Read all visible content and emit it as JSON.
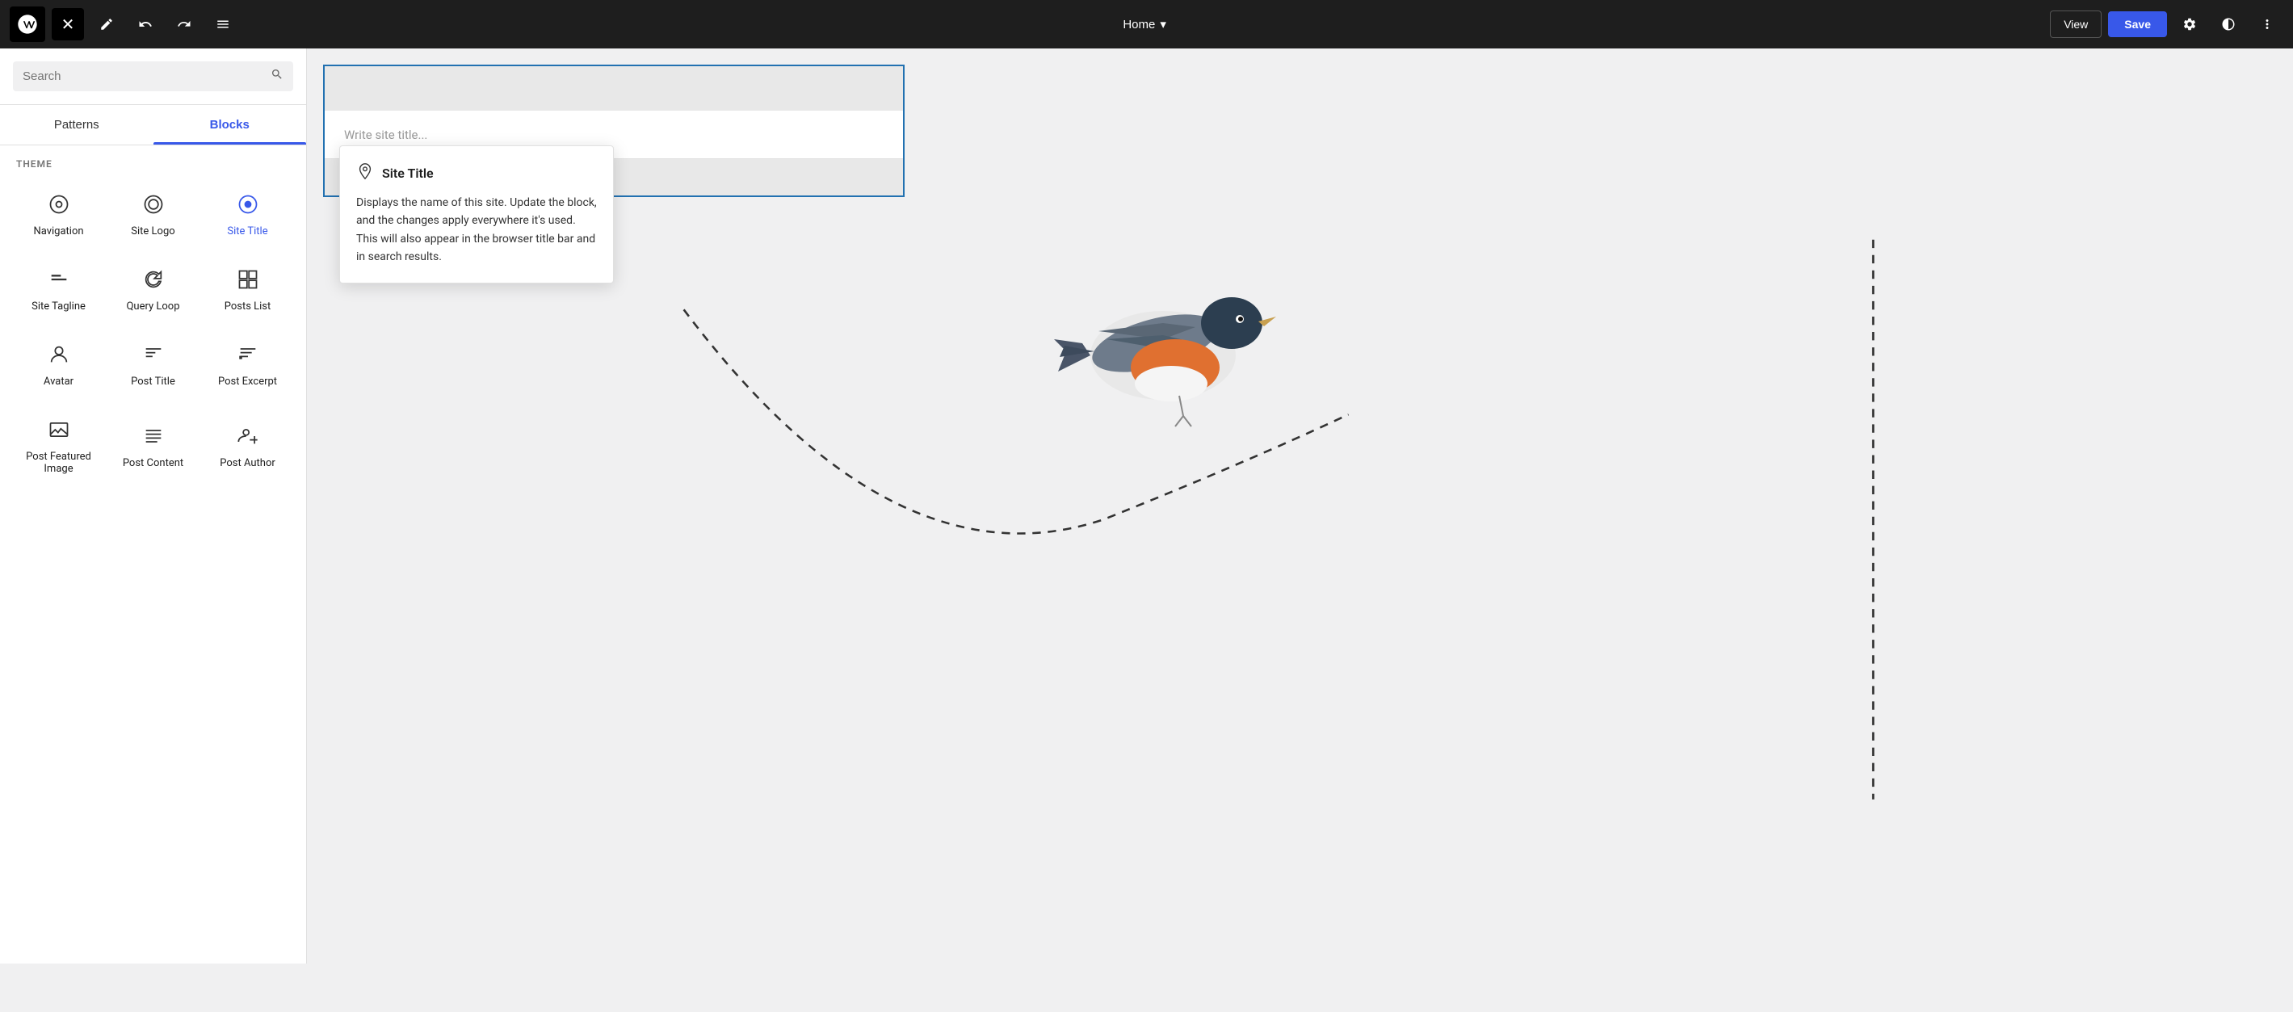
{
  "topbar": {
    "wp_logo_label": "WordPress",
    "close_label": "✕",
    "edit_icon": "✎",
    "undo_icon": "↩",
    "redo_icon": "↪",
    "list_view_icon": "☰",
    "page_title": "Home",
    "chevron_down": "▾",
    "view_label": "View",
    "save_label": "Save",
    "settings_icon": "⚙",
    "contrast_icon": "◑",
    "more_icon": "⋮"
  },
  "sidebar": {
    "search_placeholder": "Search",
    "search_icon": "🔍",
    "tabs": [
      {
        "id": "patterns",
        "label": "Patterns",
        "active": false
      },
      {
        "id": "blocks",
        "label": "Blocks",
        "active": true
      }
    ],
    "section_label": "THEME",
    "blocks": [
      {
        "id": "navigation",
        "label": "Navigation",
        "icon": "⊕",
        "highlighted": false
      },
      {
        "id": "site-logo",
        "label": "Site Logo",
        "icon": "◎",
        "highlighted": false
      },
      {
        "id": "site-title",
        "label": "Site Title",
        "icon": "⊙",
        "highlighted": true
      },
      {
        "id": "site-tagline",
        "label": "Site Tagline",
        "icon": "—",
        "highlighted": false
      },
      {
        "id": "query-loop",
        "label": "Query Loop",
        "icon": "∞",
        "highlighted": false
      },
      {
        "id": "posts-list",
        "label": "Posts List",
        "icon": "▦",
        "highlighted": false
      },
      {
        "id": "avatar",
        "label": "Avatar",
        "icon": "◉",
        "highlighted": false
      },
      {
        "id": "post-title",
        "label": "Post Title",
        "icon": "T̲",
        "highlighted": false
      },
      {
        "id": "post-excerpt",
        "label": "Post Excerpt",
        "icon": "❝",
        "highlighted": false
      },
      {
        "id": "post-featured-image",
        "label": "Post Featured Image",
        "icon": "⊟",
        "highlighted": false
      },
      {
        "id": "post-content",
        "label": "Post Content",
        "icon": "≡",
        "highlighted": false
      },
      {
        "id": "post-author",
        "label": "Post Author",
        "icon": "👤",
        "highlighted": false
      }
    ]
  },
  "editor": {
    "site_title_placeholder": "Write site title...",
    "tooltip": {
      "icon": "📍",
      "title": "Site Title",
      "description": "Displays the name of this site. Update the block, and the changes apply everywhere it's used. This will also appear in the browser title bar and in search results."
    }
  }
}
